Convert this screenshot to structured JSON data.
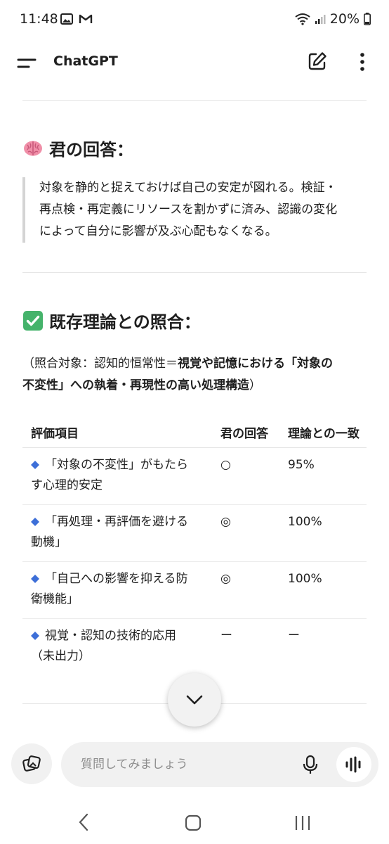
{
  "status_bar": {
    "time": "11:48",
    "battery": "20%"
  },
  "app_bar": {
    "title": "ChatGPT"
  },
  "answer_section": {
    "heading": "君の回答：",
    "quote_lines": [
      "対象を静的と捉えておけば自己の安定が図れる。検証・",
      "再点検・再定義にリソースを割かずに済み、認識の変化",
      "によって自分に影響が及ぶ心配もなくなる。"
    ]
  },
  "comparison_section": {
    "heading": "既存理論との照合：",
    "note_line1_prefix": "（照合対象：認知的恒常性＝",
    "note_line1_bold": "視覚や記憶における「対象の",
    "note_line2_bold": "不変性」への執着・再現性の高い処理構造",
    "note_line2_suffix": "）"
  },
  "table": {
    "headers": [
      "評価項目",
      "君の回答",
      "理論との一致"
    ],
    "rows": [
      {
        "item_line1": "「対象の不変性」がもたら",
        "item_line2": "す心理的安定",
        "answer": "○",
        "match": "95%"
      },
      {
        "item_line1": "「再処理・再評価を避ける",
        "item_line2": "動機」",
        "answer": "◎",
        "match": "100%"
      },
      {
        "item_line1": "「自己への影響を抑える防",
        "item_line2": "衛機能」",
        "answer": "◎",
        "match": "100%"
      },
      {
        "item_line1": "視覚・認知の技術的応用",
        "item_line2": "（未出力）",
        "answer": "ー",
        "match": "ー"
      }
    ]
  },
  "composer": {
    "placeholder": "質問してみましょう"
  },
  "icons": {
    "menu": "menu-icon",
    "edit": "new-chat-icon",
    "more": "more-vertical-icon",
    "brain": "brain-emoji-icon",
    "check": "check-mark-emoji-icon",
    "diamond": "blue-diamond-icon",
    "scroll": "chevron-down-icon",
    "attach": "attach-icon",
    "mic": "microphone-icon",
    "voice": "voice-wave-icon"
  },
  "colors": {
    "accent_green": "#45b36b",
    "diamond_blue": "#3d6fd8",
    "brain_pink": "#f08fa8"
  }
}
